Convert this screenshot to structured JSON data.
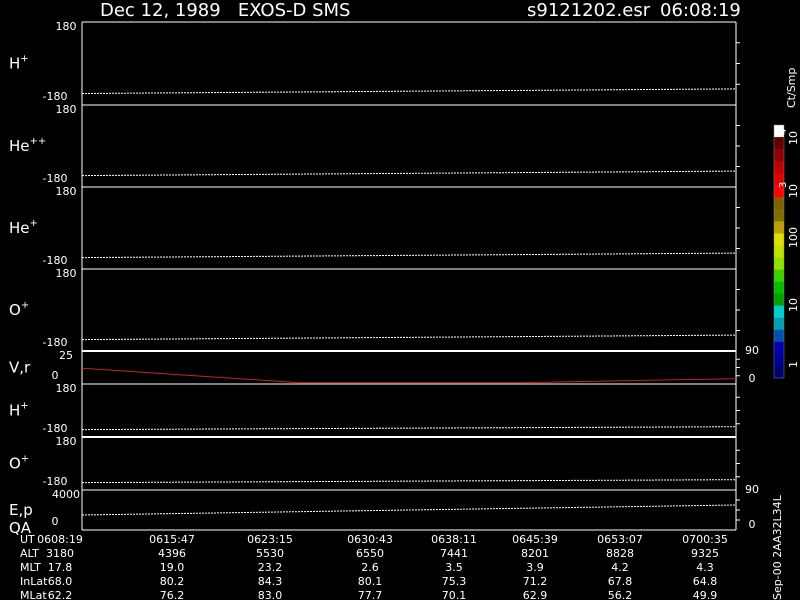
{
  "header": {
    "title": "Dec 12, 1989   EXOS-D SMS",
    "file": "s9121202.esr",
    "time": "06:08:19"
  },
  "colorbar": {
    "unit": "Ct/Smp",
    "labels": [
      "1",
      "10",
      "100",
      "10",
      "3",
      "10",
      "4"
    ],
    "colors": [
      "#000070",
      "#000090",
      "#0000b0",
      "#0050b0",
      "#00a0b0",
      "#00d0d0",
      "#00a000",
      "#00c000",
      "#40d000",
      "#90e000",
      "#c0e000",
      "#e0e000",
      "#c0a000",
      "#807000",
      "#806000",
      "#ff0000",
      "#e00000",
      "#c00000",
      "#900000",
      "#600000",
      "#ffffff"
    ]
  },
  "footer": {
    "code": "Sep-00 2AA32L34L",
    "rows": [
      {
        "label": "UT",
        "values": [
          "0608:19",
          "0615:47",
          "0623:15",
          "0630:43",
          "0638:11",
          "0645:39",
          "0653:07",
          "0700:35"
        ]
      },
      {
        "label": "ALT",
        "values": [
          "3180",
          "4396",
          "5530",
          "6550",
          "7441",
          "8201",
          "8828",
          "9325"
        ]
      },
      {
        "label": "MLT",
        "values": [
          "17.8",
          "19.0",
          "23.2",
          "2.6",
          "3.5",
          "3.9",
          "4.2",
          "4.3"
        ]
      },
      {
        "label": "InLat",
        "values": [
          "68.0",
          "80.2",
          "84.3",
          "80.1",
          "75.3",
          "71.2",
          "67.8",
          "64.8"
        ]
      },
      {
        "label": "MLat",
        "values": [
          "62.2",
          "76.2",
          "83.0",
          "77.7",
          "70.1",
          "62.9",
          "56.2",
          "49.9"
        ]
      }
    ]
  },
  "chart_data": {
    "type": "line",
    "x_ticks": [
      "0608:19",
      "0615:47",
      "0623:15",
      "0630:43",
      "0638:11",
      "0645:39",
      "0653:07",
      "0700:35"
    ],
    "panels": [
      {
        "label": "H",
        "sup": "+",
        "ymax": "180",
        "ymin": "-180",
        "line": [
          -130,
          -110
        ],
        "color": "#ffffff"
      },
      {
        "label": "He",
        "sup": "++",
        "ymax": "180",
        "ymin": "-180",
        "line": [
          -130,
          -110
        ],
        "color": "#ffffff"
      },
      {
        "label": "He",
        "sup": "+",
        "ymax": "180",
        "ymin": "-180",
        "line": [
          -130,
          -110
        ],
        "color": "#ffffff"
      },
      {
        "label": "O",
        "sup": "+",
        "ymax": "180",
        "ymin": "-180",
        "line": [
          -130,
          -110
        ],
        "color": "#ffffff"
      },
      {
        "label": "V,r",
        "sup": "",
        "ymax": "25",
        "ymin": "0",
        "rmax": "90",
        "rmin": "0",
        "line": [
          12,
          1,
          1,
          4
        ],
        "color": "#cc2020"
      },
      {
        "label": "H",
        "sup": "+",
        "ymax": "180",
        "ymin": "-180",
        "line": [
          -130,
          -110
        ],
        "color": "#ffffff"
      },
      {
        "label": "O",
        "sup": "+",
        "ymax": "180",
        "ymin": "-180",
        "line": [
          -130,
          -110
        ],
        "color": "#ffffff"
      },
      {
        "label": "E,p",
        "label2": "QA",
        "sup": "",
        "ymax": "4000",
        "ymin": "0",
        "rmax": "90",
        "rmin": "0",
        "line": [
          1500,
          2500
        ],
        "color": "#ffffff"
      }
    ]
  }
}
